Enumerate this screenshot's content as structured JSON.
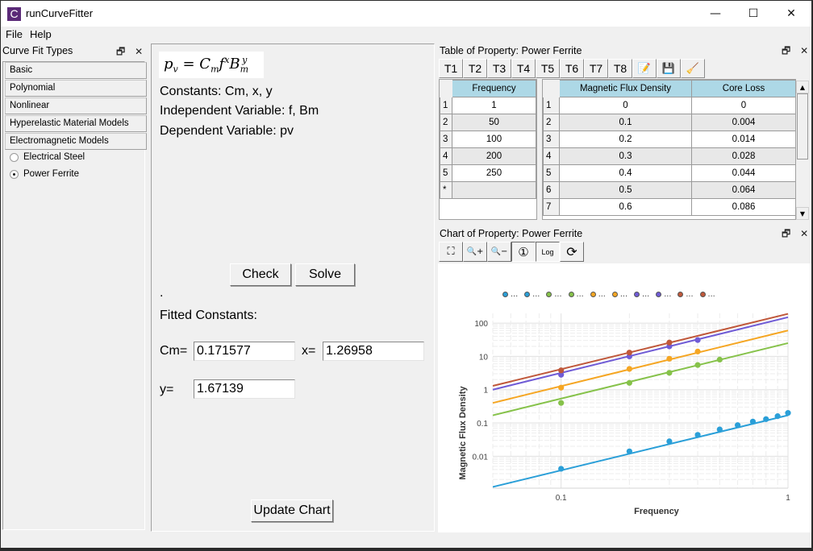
{
  "window": {
    "app_icon_letter": "C",
    "title": "runCurveFitter",
    "controls": {
      "minimize": "—",
      "maximize": "☐",
      "close": "✕"
    }
  },
  "menubar": {
    "items": [
      "File",
      "Help"
    ]
  },
  "left_dock": {
    "title": "Curve Fit Types",
    "float_icon": "🗗",
    "close_icon": "✕",
    "categories": [
      "Basic",
      "Polynomial",
      "Nonlinear",
      "Hyperelastic Material Models",
      "Electromagnetic Models"
    ],
    "options": [
      {
        "label": "Electrical Steel",
        "selected": false
      },
      {
        "label": "Power Ferrite",
        "selected": true
      }
    ]
  },
  "center": {
    "formula": {
      "lhs": "p",
      "lhs_sub": "v",
      "c": "C",
      "c_sub": "m",
      "f": "f",
      "f_sup": "x",
      "b": "B",
      "b_sub": "m",
      "b_sup": "y"
    },
    "constants_text": "Constants: Cm, x, y",
    "independent_text": "Independent Variable: f, Bm",
    "dependent_text": "Dependent Variable: pv",
    "check_label": "Check",
    "solve_label": "Solve",
    "status_dot": ".",
    "fitted_label": "Fitted Constants:",
    "cm_label": "Cm=",
    "cm_value": "0.171577",
    "x_label": "x=",
    "x_value": "1.26958",
    "y_label": "y=",
    "y_value": "1.67139",
    "update_chart_label": "Update Chart"
  },
  "table_dock": {
    "title": "Table of Property: Power Ferrite",
    "tabs": [
      "T1",
      "T2",
      "T3",
      "T4",
      "T5",
      "T6",
      "T7",
      "T8"
    ],
    "tool_icons": [
      "edit-icon",
      "save-icon",
      "clear-icon"
    ],
    "tool_glyphs": [
      "📝",
      "💾",
      "🧹"
    ],
    "freq_table": {
      "header": "Frequency",
      "rows": [
        {
          "index": "1",
          "value": "1"
        },
        {
          "index": "2",
          "value": "50"
        },
        {
          "index": "3",
          "value": "100"
        },
        {
          "index": "4",
          "value": "200"
        },
        {
          "index": "5",
          "value": "250"
        },
        {
          "index": "*",
          "value": ""
        }
      ]
    },
    "bm_table": {
      "headers": [
        "Magnetic Flux Density",
        "Core Loss"
      ],
      "rows": [
        {
          "index": "1",
          "bm": "0",
          "loss": "0"
        },
        {
          "index": "2",
          "bm": "0.1",
          "loss": "0.004"
        },
        {
          "index": "3",
          "bm": "0.2",
          "loss": "0.014"
        },
        {
          "index": "4",
          "bm": "0.3",
          "loss": "0.028"
        },
        {
          "index": "5",
          "bm": "0.4",
          "loss": "0.044"
        },
        {
          "index": "6",
          "bm": "0.5",
          "loss": "0.064"
        },
        {
          "index": "7",
          "bm": "0.6",
          "loss": "0.086"
        }
      ]
    }
  },
  "chart_dock": {
    "title": "Chart of Property: Power Ferrite",
    "tools": [
      {
        "name": "fit-view-icon",
        "glyph": "⛶",
        "pressed": false
      },
      {
        "name": "zoom-in-icon",
        "glyph": "🔍+",
        "pressed": false
      },
      {
        "name": "zoom-out-icon",
        "glyph": "🔍−",
        "pressed": false
      },
      {
        "name": "info-icon",
        "glyph": "①",
        "pressed": true
      },
      {
        "name": "log-scale-toggle",
        "glyph": "Log",
        "pressed": true
      },
      {
        "name": "refresh-icon",
        "glyph": "⟳",
        "pressed": false
      }
    ]
  },
  "chart_data": {
    "type": "scatter",
    "title": "",
    "xlabel": "Frequency",
    "ylabel": "Magnetic Flux Density",
    "xscale": "log",
    "yscale": "log",
    "xlim": [
      0.05,
      1
    ],
    "ylim": [
      0.0011,
      196
    ],
    "xticks": [
      {
        "v": 0.1,
        "label": "0.1"
      },
      {
        "v": 1,
        "label": "1"
      }
    ],
    "yticks": [
      {
        "v": 0.01,
        "label": "0.01"
      },
      {
        "v": 0.1,
        "label": "0.1"
      },
      {
        "v": 1,
        "label": "1"
      },
      {
        "v": 10,
        "label": "10"
      },
      {
        "v": 100,
        "label": "100"
      }
    ],
    "grid": true,
    "legend_position": "top-center",
    "legend_label": "...",
    "series": [
      {
        "name": "...",
        "kind": "points",
        "color": "#2a9fd8",
        "x": [
          0.1,
          0.2,
          0.3,
          0.4,
          0.5,
          0.6,
          0.7,
          0.8,
          0.9,
          1.0
        ],
        "y": [
          0.0042,
          0.014,
          0.028,
          0.044,
          0.064,
          0.086,
          0.11,
          0.13,
          0.16,
          0.2
        ]
      },
      {
        "name": "...",
        "kind": "line",
        "color": "#2a9fd8",
        "x": [
          0.05,
          1
        ],
        "y": [
          0.0012,
          0.17
        ]
      },
      {
        "name": "...",
        "kind": "points",
        "color": "#86c24a",
        "x": [
          0.1,
          0.2,
          0.3,
          0.4,
          0.5
        ],
        "y": [
          0.4,
          1.6,
          3.2,
          5.5,
          8.0
        ]
      },
      {
        "name": "...",
        "kind": "line",
        "color": "#86c24a",
        "x": [
          0.05,
          1
        ],
        "y": [
          0.17,
          25
        ]
      },
      {
        "name": "...",
        "kind": "points",
        "color": "#f5a623",
        "x": [
          0.1,
          0.2,
          0.3,
          0.4
        ],
        "y": [
          1.15,
          4.2,
          8.5,
          14
        ]
      },
      {
        "name": "...",
        "kind": "line",
        "color": "#f5a623",
        "x": [
          0.05,
          1
        ],
        "y": [
          0.4,
          60
        ]
      },
      {
        "name": "...",
        "kind": "points",
        "color": "#6f5bd6",
        "x": [
          0.1,
          0.2,
          0.3,
          0.4
        ],
        "y": [
          2.8,
          10,
          20,
          31
        ]
      },
      {
        "name": "...",
        "kind": "line",
        "color": "#6f5bd6",
        "x": [
          0.05,
          1
        ],
        "y": [
          1.0,
          150
        ]
      },
      {
        "name": "...",
        "kind": "points",
        "color": "#c0583a",
        "x": [
          0.1,
          0.2,
          0.3
        ],
        "y": [
          3.8,
          13,
          26
        ]
      },
      {
        "name": "...",
        "kind": "line",
        "color": "#c0583a",
        "x": [
          0.05,
          1
        ],
        "y": [
          1.3,
          190
        ]
      }
    ]
  }
}
